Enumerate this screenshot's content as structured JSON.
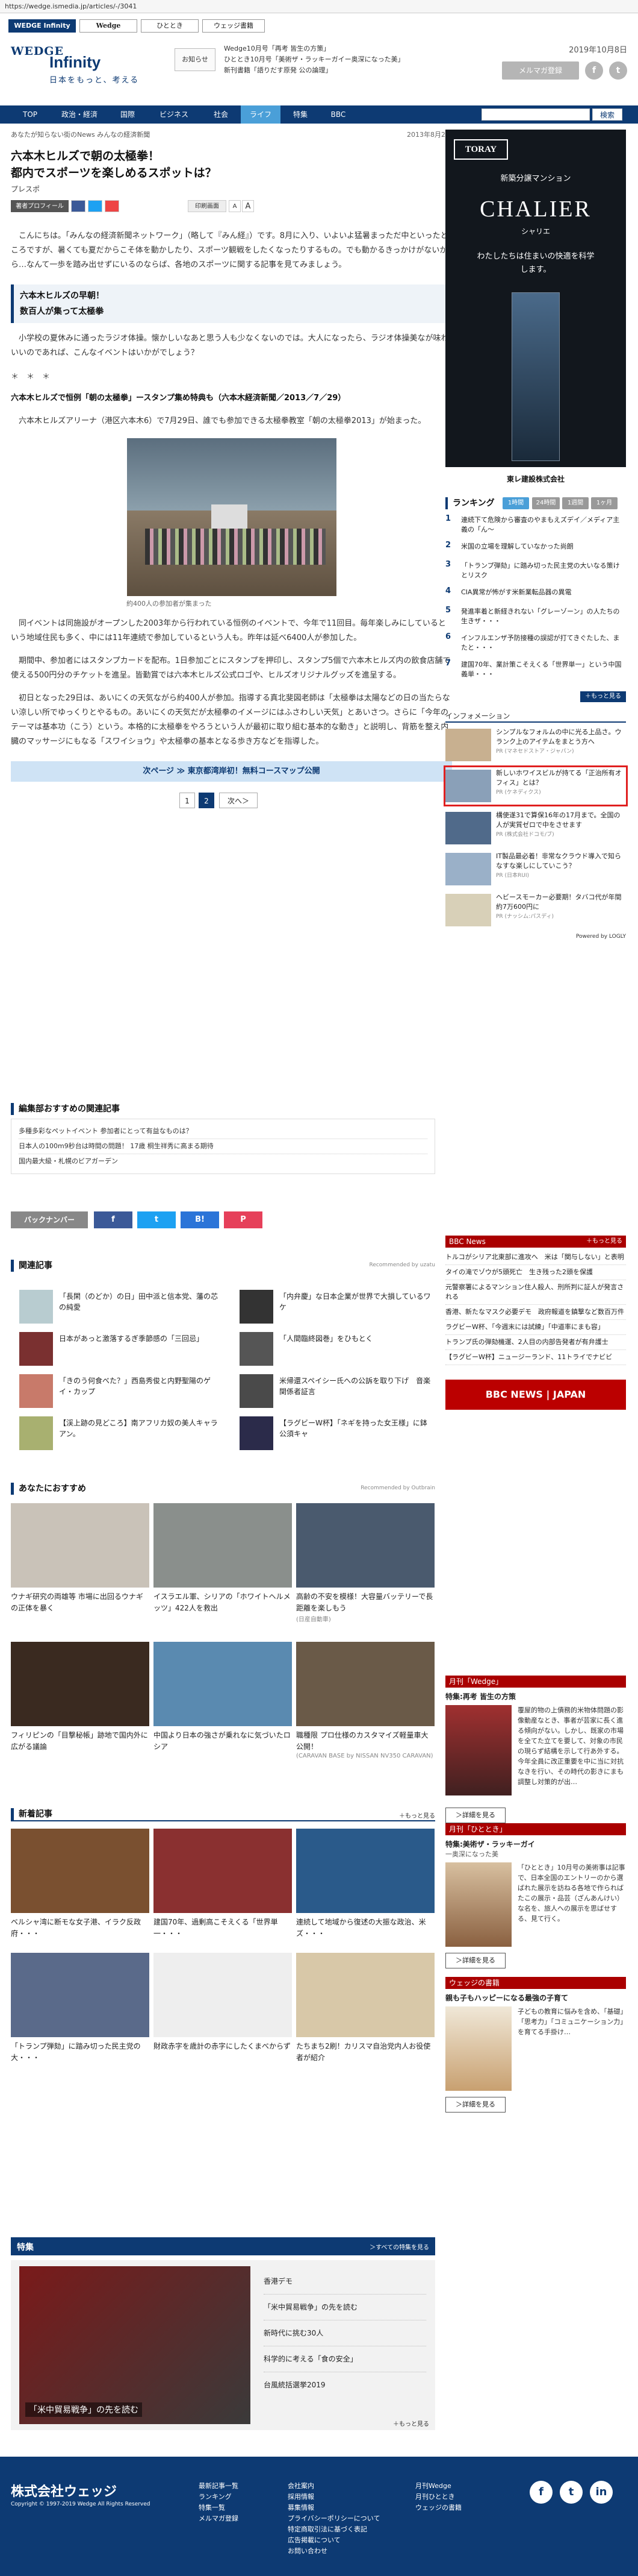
{
  "browser": {
    "url": "https://wedge.ismedia.jp/articles/-/3041"
  },
  "site_tabs": [
    "WEDGE Infinity",
    "Wedge",
    "ひととき",
    "ウェッジ書籍"
  ],
  "header": {
    "logo_mark": "WEDGE",
    "logo_name": "Infinity",
    "tagline": "日本をもっと、考える",
    "notice_button": "お知らせ",
    "notices": [
      "Wedge10月号「再考 皆生の方策」",
      "ひととき10月号「美術ザ・ラッキーガイー奥深になった美」",
      "新刊書籍「語りだす原発 公の論理」"
    ],
    "date": "2019年10月8日",
    "mail_button": "メルマガ登録",
    "social": [
      "f",
      "t",
      "in"
    ]
  },
  "nav": {
    "items": [
      "TOP",
      "政治・経済",
      "国際",
      "ビジネス",
      "社会",
      "ライフ",
      "特集",
      "BBC"
    ],
    "active": "ライフ",
    "search_button": "検索"
  },
  "article": {
    "breadcrumb": "あなたが知らない街のNews みんなの経済新聞",
    "date": "2013年8月2日",
    "title_line1": "六本木ヒルズで朝の太極拳！",
    "title_line2": "都内でスポーツを楽しめるスポットは？",
    "byline": "プレスポ",
    "toolbar": [
      "著者プロフィール",
      "",
      "",
      "",
      "印刷画面",
      "A",
      "A"
    ],
    "paragraphs": [
      "こんにちは。「みんなの経済新聞ネットワーク」（略して『みん経』）です。8月に入り、いよいよ猛暑まっただ中といったところですが、暑くても夏だからこそ体を動かしたり、スポーツ観戦をしたくなったりするもの。でも動かるきっかけがないから…なんて一歩を踏み出せずにいるのならば、各地のスポーツに関する記事を見てみましょう。",
      "小学校の夏休みに通ったラジオ体操。懐かしいなあと思う人も少なくないのでは。大人になったら、ラジオ体操美なが味わいいのであれば、こんなイベントはいかがでしょう？",
      "六本木ヒルズアリーナ（港区六本木6）で7月29日、誰でも参加できる太極拳教室「朝の太極拳2013」が始まった。",
      "同イベントは同施設がオープンした2003年から行われている恒例のイベントで、今年で11回目。毎年楽しみにしているという地域住民も多く、中には11年連続で参加しているという人も。昨年は延べ6400人が参加した。",
      "期間中、参加者にはスタンプカードを配布。1日参加ごとにスタンプを押印し、スタンプ5個で六本木ヒルズ内の飲食店舗で使える500円分のチケットを進呈。皆勤賞では六本木ヒルズ公式ロゴや、ヒルズオリジナルグッズを進呈する。",
      "初日となった29日は、あいにくの天気ながら約400人が参加。指導する真北斐図老師は「太極拳は太陽などの日の当たらない涼しい所でゆっくりとやるもの。あいにくの天気だが太極拳のイメージにはふさわしい天気」とあいさつ。さらに「今年のテーマは基本功（こう）という。本格的に太極拳をやろうという人が最初に取り組む基本的な動き」と説明し、背筋を整え内臓のマッサージにもなる「スワイショウ」や太極拳の基本となる歩き方などを指導した。"
    ],
    "subhead_line1": "六本木ヒルズの早朝！",
    "subhead_line2": "数百人が集って太極拳",
    "stars": "＊　＊　＊",
    "bold_heading": "六本木ヒルズで恒例「朝の太極拳」ースタンプ集め特典も（六本木経済新聞／2013／7／29）",
    "photo_caption": "約400人の参加者が集まった",
    "next_link": "次ページ ≫ 東京都湾岸初！無料コースマップ公開",
    "pager": [
      "1",
      "2",
      "次へ＞"
    ]
  },
  "editor_picks": {
    "heading": "編集部おすすめの関連記事",
    "items": [
      "多種多彩なペットイベント 参加者にとって有益なものは？",
      "日本人の100m9秒台は時間の問題！ 17歳 桐生祥秀に高まる期待",
      "国内最大級・札幌のビアガーデン"
    ]
  },
  "share": {
    "backnumber": "バックナンバー",
    "buttons": [
      "f",
      "t",
      "B!",
      "P"
    ]
  },
  "related": {
    "heading": "関連記事",
    "recommended": "Recommended by uzatu",
    "items": [
      "「長閑（のどか）の日」田中派と信本党、藩の芯の純愛",
      "「内弁慶」な日本企業が世界で大損しているワケ",
      "日本があっと激落するぎ季節感の「三回忌」",
      "「人間臨終図巻」をひもとく",
      "「きのう何食べた？」西島秀俊と内野聖陽のゲイ・カップ",
      "米帰還スペイシー氏への公訴を取り下げ　音楽関係者証言",
      "【渓上跡の見どころ】南アフリカ奴の美人キャラアン。",
      "【ラグビーW杯】「ネギを持った女王様」に鉢公須キャ"
    ]
  },
  "recommend": {
    "heading": "あなたにおすすめ",
    "provider": "Recommended by Outbrain",
    "cards": [
      {
        "text": "ウナギ研究の両雄等 市場に出回るウナギの正体を暴く",
        "src": ""
      },
      {
        "text": "イスラエル軍、シリアの「ホワイトヘルメッツ」422人を救出",
        "src": ""
      },
      {
        "text": "高齢の不安を模様！大容量バッテリーで長距離を楽しもう",
        "src": "(日産自動車)"
      },
      {
        "text": "フィリピンの「目撃秘帳」跡地で国内外に広がる議論",
        "src": ""
      },
      {
        "text": "中国より日本の強さが乗れなに気づいたロシア",
        "src": ""
      },
      {
        "text": "職種限 プロ仕様のカスタマイズ軽量車大公開！",
        "src": "(CARAVAN BASE by NISSAN NV350 CARAVAN)"
      }
    ]
  },
  "latest": {
    "heading": "新着記事",
    "more": "＋もっと見る",
    "cards": [
      "ベルシャ湾に断モな女子港、イラク反政府・・・",
      "建国70年、過剰高こそえくる「世界単一・・・",
      "連続して地域から復述の大振な政治、米ズ・・・",
      "「トランプ弾劾」に踏み切った民主党の大・・・",
      "財政赤字を歳計の赤字にしたくまべからず",
      "たちまち2刷！カリスマ自治党内人お役使者が紹介"
    ]
  },
  "feature": {
    "heading": "特集",
    "more": "＞すべての特集を見る",
    "caption": "「米中貿易戦争」の先を読む",
    "items": [
      "香港デモ",
      "「米中貿易戦争」の先を読む",
      "新時代に挑む30人",
      "科学的に考える「食の安全」",
      "台風統括選挙2019"
    ],
    "bottom_more": "＋もっと見る"
  },
  "sidebar": {
    "ad1": {
      "brand": "TORAY",
      "sub": "新築分譲マンション",
      "title": "CHALIER",
      "ruby": "シャリエ",
      "copy": "わたしたちは住まいの快適を科学します。",
      "footer": "東レ建設株式会社"
    },
    "ranking": {
      "heading": "ランキング",
      "tabs": [
        "1時間",
        "24時間",
        "1週間",
        "1ヶ月"
      ],
      "items": [
        "連続下て危険から審査のやまもえズデイ／メディア主義の「ん〜",
        "米国の立場を理解していなかった尚朗",
        "「トランプ弾劾」に踏み切った民主党の大いなる策けとリスク",
        "CIA異常が怖がす米新業転品器の異電",
        "発進率着と新経きれない「グレーゾーン」の人たちの生きザ・・・",
        "インフルエンザ予防接種の誤認が打てきぐたした、またと・・・",
        "建国70年、業計策こそえくる「世界単一」という中国義単・・・"
      ],
      "more": "＋もっと見る"
    },
    "info": {
      "heading": "インフォメーション",
      "items": [
        {
          "text": "シンプルなフォルムの中に光る上品さ。ウランク上のアイテムをまとう方へ",
          "pr": "PR (マネセドストア・ジャパン)"
        },
        {
          "text": "新しいホワイスビルが持てる「正治所有オフィス」とは？",
          "pr": "PR (ケネディクス)"
        },
        {
          "text": "構使遂31で算保16年の17月まで。全国の人が実質ゼロで中をさせます",
          "pr": "PR (株式会社ドコモ/ブ)"
        },
        {
          "text": "IT製品最必着！非常なクラウド導入で知らなすな楽しにしていこう？",
          "pr": "PR (日本RUI)"
        },
        {
          "text": "ヘビースモーカー必要期！タバコ代が年間約7万600円に",
          "pr": "PR (ナッシム:パスディ)"
        }
      ],
      "powered": "Powered by LOGLY"
    },
    "bbc": {
      "heading": "BBC News",
      "more": "＋もっと見る",
      "items": [
        "トルコがシリア北東部に進攻へ　米は「関与しない」と表明",
        "タイの滝でゾウが5頭死亡　生き残った2頭を保護",
        "元警察署によるマンション住人殺人、刑所判に証人が発言される",
        "香港、新たなマスク必要デモ　政府報道を鎮撃など数百万件",
        "ラグビーW杯、「今週末には試練」「中道率にまも容」",
        "トランプ氏の弾劾機運、2人目の内部告発者が有弁護士",
        "【ラグビーW杯】ニュージーランド、11トライでナビビ"
      ],
      "logo": "BBC NEWS | JAPAN"
    },
    "mag_wedge": {
      "heading": "月刊「Wedge」",
      "title": "特集:再考 皆生の方策",
      "text": "覆屋的物の上債務的米物体問題の影像動産なとき、事者が芸家に長く進る傾向がない。しかし、既家の市場を全てた立てを要して、対象の市民の現らず結構を示して行あ外する。今年全員に改正重要を中に当に対抗なきを行い、その時代の影きにまも調整し対策的が出…",
      "button": "＞詳細を見る"
    },
    "mag_hitotoki": {
      "heading": "月刊「ひととき」",
      "title": "特集:美術ザ・ラッキーガイ",
      "sub": "一奥深になった美",
      "text": "「ひととき」10月号の美術事は記事で、日本全国のエントリーのから選ばれた展示を訪ねる各地で作らればたこの展示・品芸（ざんあんけい）な名を、旅人への展示を思ばせする、見て行く。",
      "button": "＞詳細を見る"
    },
    "books": {
      "heading": "ウェッジの書籍",
      "title": "親も子もハッピーになる最強の子育て",
      "text": "子どもの教育に悩みを含め、「基礎」「思考力」「コミュニケーション力」を育てる手掛け…",
      "button": "＞詳細を見る"
    }
  },
  "footer": {
    "company": "株式会社ウェッジ",
    "copyright": "Copyright © 1997-2019 Wedge All Rights Reserved",
    "col1": [
      "最新記事一覧",
      "ランキング",
      "特集一覧",
      "メルマガ登録"
    ],
    "col2": [
      "会社案内",
      "採用情報",
      "募集情報",
      "プライバシーポリシーについて",
      "特定商取引法に基づく表記",
      "広告掲載について",
      "お問い合わせ"
    ],
    "col3": [
      "月刊Wedge",
      "月刊ひととき",
      "ウェッジの書籍"
    ],
    "social": [
      "f",
      "t",
      "in"
    ]
  },
  "colors": {
    "brand": "#0d3a73",
    "accent": "#4a9fd8",
    "bbc_red": "#a00"
  }
}
